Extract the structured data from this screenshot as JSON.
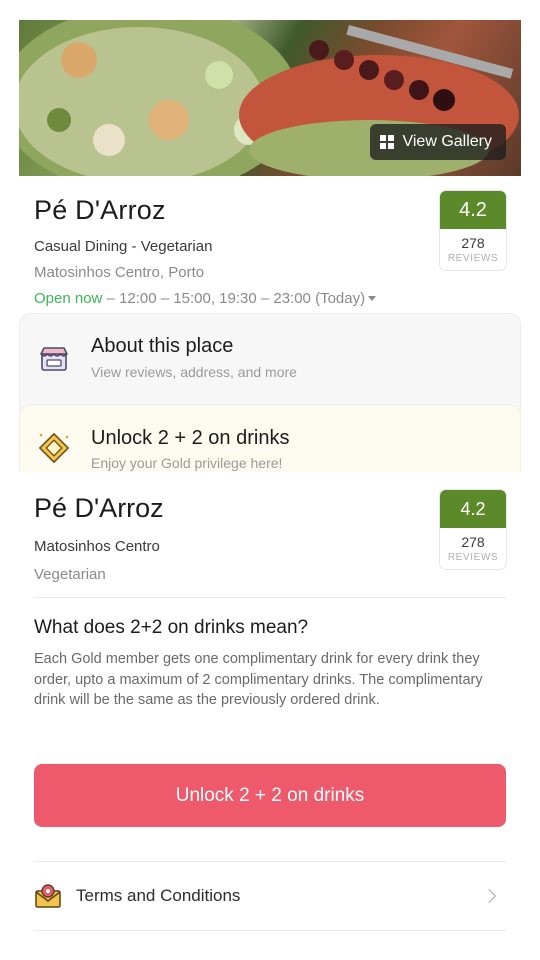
{
  "hero": {
    "gallery_label": "View Gallery"
  },
  "restaurant": {
    "name": "Pé D'Arroz",
    "cuisine": "Casual Dining - Vegetarian",
    "location": "Matosinhos Centro, Porto",
    "open_status": "Open now",
    "hours": " – 12:00 – 15:00, 19:30 – 23:00 (Today)",
    "rating": "4.2",
    "reviews_count": "278",
    "reviews_label": "REVIEWS"
  },
  "about": {
    "title": "About this place",
    "subtitle": "View reviews, address, and more"
  },
  "gold": {
    "title": "Unlock 2 + 2 on drinks",
    "subtitle": "Enjoy your Gold privilege here!"
  },
  "sheet": {
    "name": "Pé D'Arroz",
    "location": "Matosinhos Centro",
    "category": "Vegetarian",
    "rating": "4.2",
    "reviews_count": "278",
    "reviews_label": "REVIEWS",
    "question": "What does 2+2 on drinks mean?",
    "answer": "Each Gold member gets one complimentary drink for every drink they order, upto a maximum of 2 complimentary drinks. The complimentary drink will be the same as the previously ordered drink.",
    "cta_label": "Unlock 2 + 2 on drinks",
    "terms_label": "Terms and Conditions"
  },
  "colors": {
    "rating_green": "#5c8a2a",
    "open_green": "#3ab757",
    "cta_red": "#ee5a6c"
  },
  "icons": {
    "gallery": "grid-icon",
    "about": "storefront-icon",
    "gold": "diamond-offer-icon",
    "terms": "envelope-badge-icon",
    "terms_arrow": "chevron-right-icon"
  }
}
